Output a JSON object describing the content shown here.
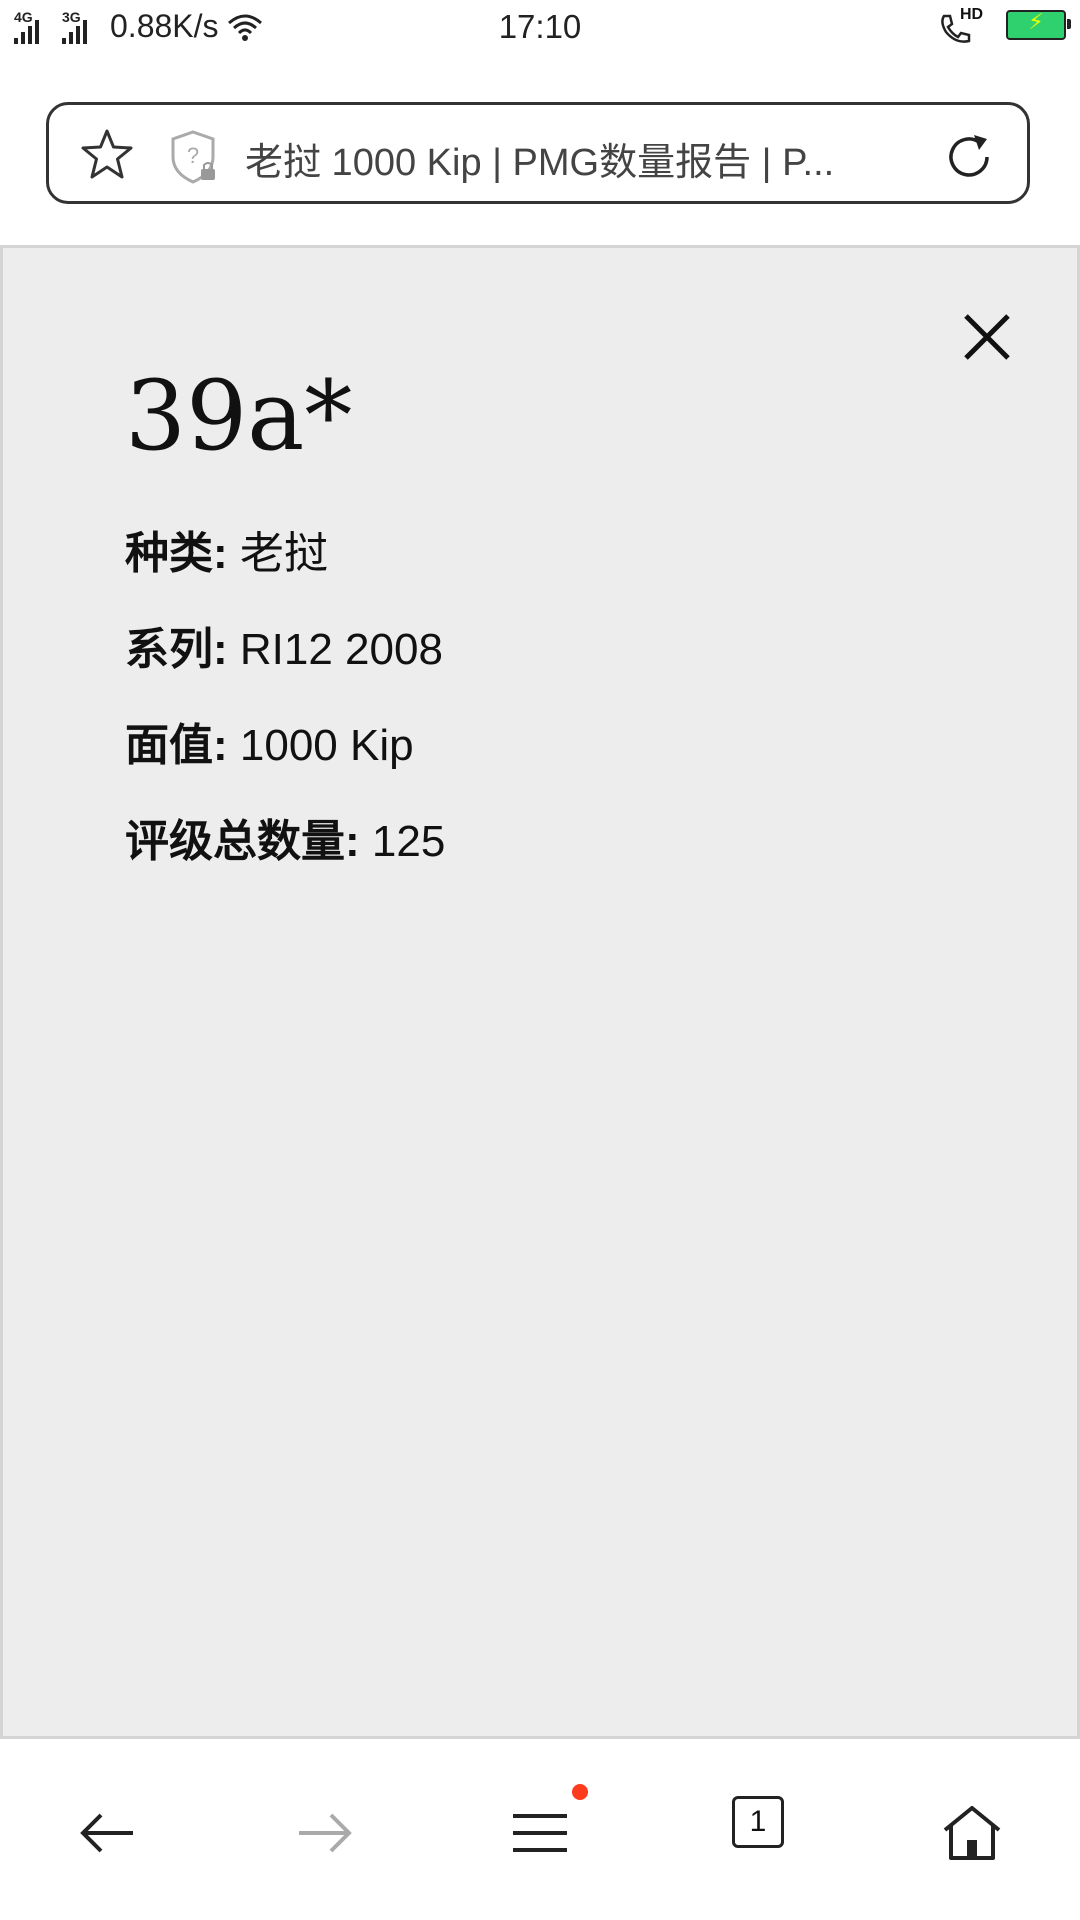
{
  "status_bar": {
    "network1": "4G",
    "network2": "3G",
    "speed": "0.88K/s",
    "time": "17:10",
    "call_badge": "HD",
    "battery_color": "#2fd16e"
  },
  "address_bar": {
    "title": "老挝 1000 Kip | PMG数量报告 | P..."
  },
  "panel": {
    "title": "39a*",
    "rows": [
      {
        "key": "种类:",
        "value": " 老挝"
      },
      {
        "key": "系列:",
        "value": " RI12 2008"
      },
      {
        "key": "面值:",
        "value": " 1000 Kip"
      },
      {
        "key": "评级总数量:",
        "value": " 125"
      }
    ]
  },
  "bottom_nav": {
    "tab_count": "1",
    "notification_color": "#ff3b1d"
  }
}
